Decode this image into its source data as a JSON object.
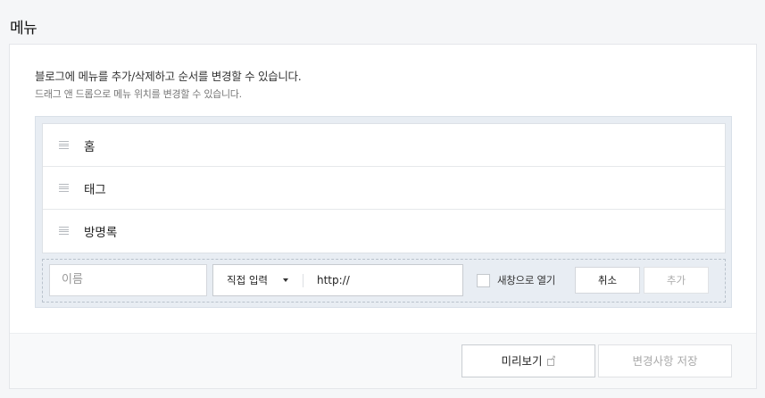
{
  "page": {
    "title": "메뉴"
  },
  "description": {
    "main": "블로그에 메뉴를 추가/삭제하고 순서를 변경할 수 있습니다.",
    "sub": "드래그 앤 드롭으로 메뉴 위치를 변경할 수 있습니다."
  },
  "menu": {
    "items": [
      {
        "label": "홈"
      },
      {
        "label": "태그"
      },
      {
        "label": "방명록"
      }
    ]
  },
  "add_form": {
    "name_placeholder": "이름",
    "type_selected": "직접 입력",
    "url_value": "http://",
    "new_window_label": "새창으로 열기",
    "new_window_checked": false,
    "cancel_label": "취소",
    "add_label": "추가"
  },
  "footer": {
    "preview_label": "미리보기",
    "preview_icon": "external-link-icon",
    "save_label": "변경사항 저장"
  }
}
